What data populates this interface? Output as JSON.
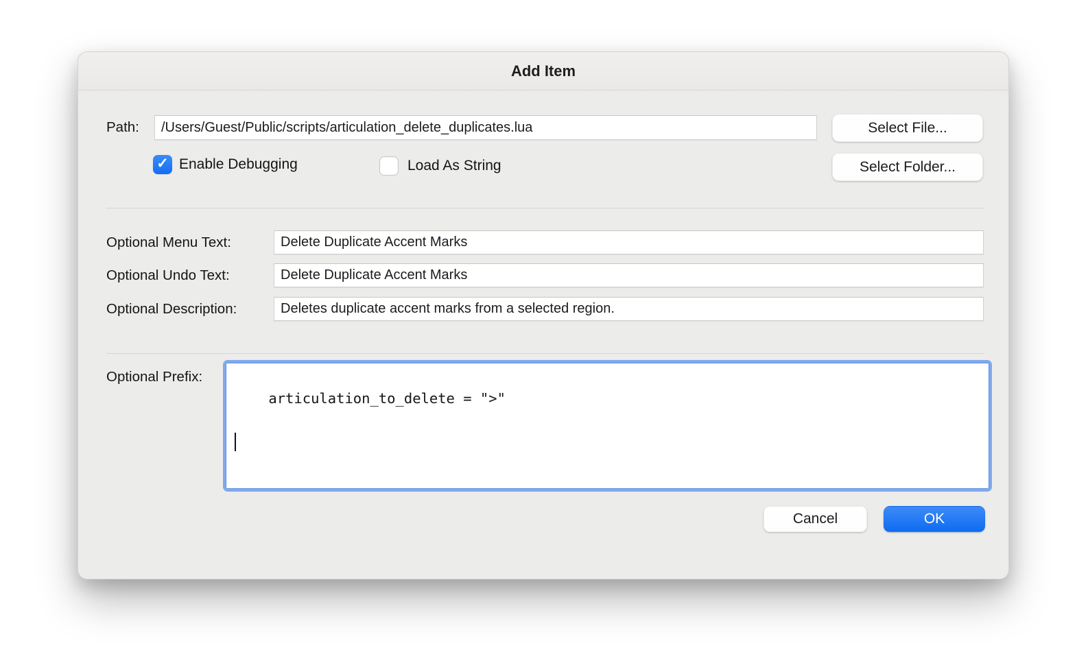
{
  "icons": {
    "checkmark": "✓"
  },
  "dialog": {
    "title": "Add Item",
    "path": {
      "label": "Path:",
      "value": "/Users/Guest/Public/scripts/articulation_delete_duplicates.lua"
    },
    "checkboxes": {
      "enable_debugging": {
        "label": "Enable Debugging",
        "checked": true
      },
      "load_as_string": {
        "label": "Load As String",
        "checked": false
      }
    },
    "buttons": {
      "select_file": "Select File...",
      "select_folder": "Select Folder...",
      "cancel": "Cancel",
      "ok": "OK"
    },
    "fields": {
      "menu_text": {
        "label": "Optional Menu Text:",
        "value": "Delete Duplicate Accent Marks"
      },
      "undo_text": {
        "label": "Optional Undo Text:",
        "value": "Delete Duplicate Accent Marks"
      },
      "description": {
        "label": "Optional Description:",
        "value": "Deletes duplicate accent marks from a selected region."
      },
      "prefix": {
        "label": "Optional Prefix:",
        "value": "articulation_to_delete = \">\""
      }
    },
    "colors": {
      "accent_blue": "#1272f3",
      "checkbox_blue": "#1f7cf6",
      "focus_ring": "#82a9ed",
      "dialog_background": "#ececeb"
    }
  }
}
